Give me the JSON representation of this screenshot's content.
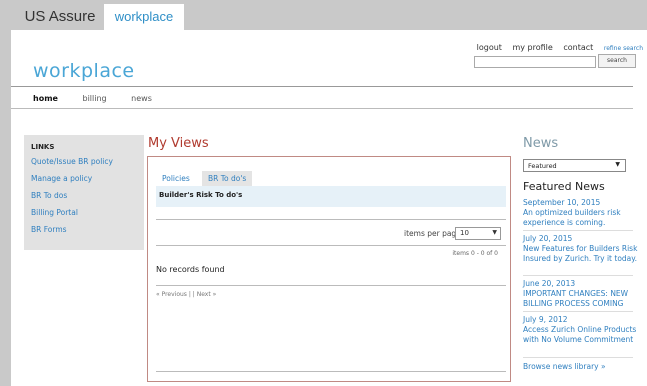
{
  "tabs": {
    "us_assure": "US Assure",
    "workplace": "workplace"
  },
  "toplinks": {
    "logout": "logout",
    "profile": "my profile",
    "contact": "contact",
    "refine": "refine search"
  },
  "search": {
    "button": "search",
    "value": ""
  },
  "brand": "workplace",
  "nav": {
    "home": "home",
    "billing": "billing",
    "news": "news"
  },
  "sidebar": {
    "title": "LINKS",
    "items": [
      {
        "label": "Quote/Issue BR policy"
      },
      {
        "label": "Manage a policy"
      },
      {
        "label": "BR To dos"
      },
      {
        "label": "Billing Portal"
      },
      {
        "label": "BR Forms"
      }
    ]
  },
  "views": {
    "title": "My Views",
    "tabs": {
      "policies": "Policies",
      "br_todo": "BR To do's"
    },
    "section_label": "Builder's Risk To do's",
    "items_per_page_label": "items per page",
    "items_per_page_value": "10",
    "items_count": "items 0 - 0 of 0",
    "no_records": "No records found",
    "pager": "« Previous | | Next »"
  },
  "news": {
    "title": "News",
    "filter": "Featured",
    "featured_title": "Featured News",
    "items": [
      {
        "date": "September 10, 2015",
        "text": "An optimized builders risk experience is coming."
      },
      {
        "date": "July 20, 2015",
        "text": "New Features for Builders Risk Insured by Zurich. Try it today."
      },
      {
        "date": "June 20, 2013",
        "text": "IMPORTANT CHANGES: NEW BILLING PROCESS COMING"
      },
      {
        "date": "July 9, 2012",
        "text": "Access Zurich Online Products with No Volume Commitment"
      }
    ],
    "browse": "Browse news library »"
  },
  "colors": {
    "brand_blue": "#4aa6d6",
    "link_blue": "#2f7fbf",
    "views_red": "#b03a2e"
  }
}
